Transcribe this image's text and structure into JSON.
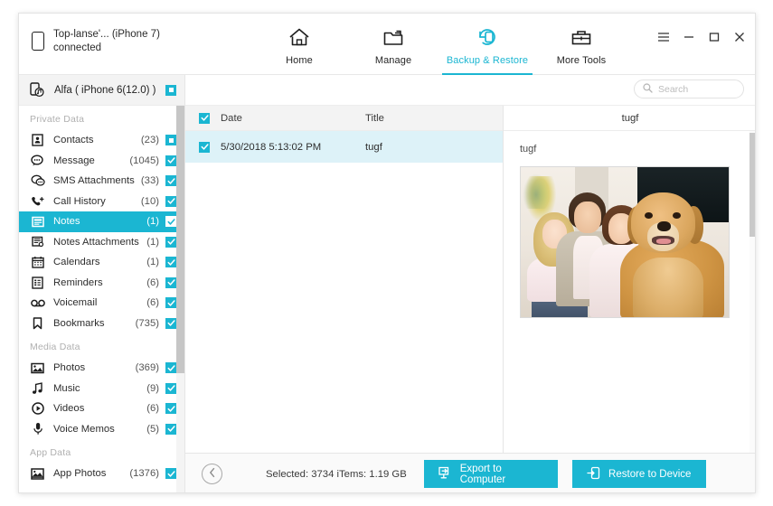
{
  "window": {
    "device_name": "Top-lanse'... (iPhone 7)",
    "device_status": "connected",
    "controls": {
      "menu": "☰",
      "minimize": "–",
      "maximize": "▭",
      "close": "✕"
    }
  },
  "nav": {
    "tabs": [
      {
        "label": "Home",
        "icon": "home-icon",
        "active": false
      },
      {
        "label": "Manage",
        "icon": "folder-icon",
        "active": false
      },
      {
        "label": "Backup & Restore",
        "icon": "backup-restore-icon",
        "active": true
      },
      {
        "label": "More Tools",
        "icon": "toolbox-icon",
        "active": false
      }
    ],
    "accent": "#1bb6d2"
  },
  "sidebar": {
    "device_selector": {
      "label": "Alfa ( iPhone 6(12.0) )",
      "icon": "device-music-icon",
      "checkbox": "partial"
    },
    "groups": [
      {
        "label": "Private Data",
        "items": [
          {
            "label": "Contacts",
            "count": "(23)",
            "icon": "contacts-icon",
            "checkbox": "partial",
            "selected": false
          },
          {
            "label": "Message",
            "count": "(1045)",
            "icon": "message-icon",
            "checkbox": "checked",
            "selected": false
          },
          {
            "label": "SMS Attachments",
            "count": "(33)",
            "icon": "sms-attachments-icon",
            "checkbox": "checked",
            "selected": false
          },
          {
            "label": "Call History",
            "count": "(10)",
            "icon": "call-history-icon",
            "checkbox": "checked",
            "selected": false
          },
          {
            "label": "Notes",
            "count": "(1)",
            "icon": "notes-icon",
            "checkbox": "checked",
            "selected": true
          },
          {
            "label": "Notes Attachments",
            "count": "(1)",
            "icon": "notes-attachments-icon",
            "checkbox": "checked",
            "selected": false
          },
          {
            "label": "Calendars",
            "count": "(1)",
            "icon": "calendar-icon",
            "checkbox": "checked",
            "selected": false
          },
          {
            "label": "Reminders",
            "count": "(6)",
            "icon": "reminders-icon",
            "checkbox": "checked",
            "selected": false
          },
          {
            "label": "Voicemail",
            "count": "(6)",
            "icon": "voicemail-icon",
            "checkbox": "checked",
            "selected": false
          },
          {
            "label": "Bookmarks",
            "count": "(735)",
            "icon": "bookmark-icon",
            "checkbox": "checked",
            "selected": false
          }
        ]
      },
      {
        "label": "Media Data",
        "items": [
          {
            "label": "Photos",
            "count": "(369)",
            "icon": "photos-icon",
            "checkbox": "checked",
            "selected": false
          },
          {
            "label": "Music",
            "count": "(9)",
            "icon": "music-icon",
            "checkbox": "checked",
            "selected": false
          },
          {
            "label": "Videos",
            "count": "(6)",
            "icon": "videos-icon",
            "checkbox": "checked",
            "selected": false
          },
          {
            "label": "Voice Memos",
            "count": "(5)",
            "icon": "voice-memos-icon",
            "checkbox": "checked",
            "selected": false
          }
        ]
      },
      {
        "label": "App Data",
        "items": [
          {
            "label": "App Photos",
            "count": "(1376)",
            "icon": "app-photos-icon",
            "checkbox": "checked",
            "selected": false
          }
        ]
      }
    ]
  },
  "search": {
    "placeholder": "Search",
    "value": "",
    "icon": "search-icon"
  },
  "list": {
    "columns": [
      "Date",
      "Title"
    ],
    "header_checkbox": "checked",
    "rows": [
      {
        "checkbox": "checked",
        "date": "5/30/2018 5:13:02 PM",
        "title": "tugf",
        "selected": true
      }
    ]
  },
  "preview": {
    "header_title": "tugf",
    "note_title": "tugf",
    "photo_alt": "family-with-golden-retriever-photo"
  },
  "footer": {
    "back_icon": "chevron-left-icon",
    "selection_summary": "Selected: 3734 iTems: 1.19 GB",
    "export_label": "Export to Computer",
    "export_icon": "export-to-computer-icon",
    "restore_label": "Restore to Device",
    "restore_icon": "restore-to-device-icon"
  }
}
